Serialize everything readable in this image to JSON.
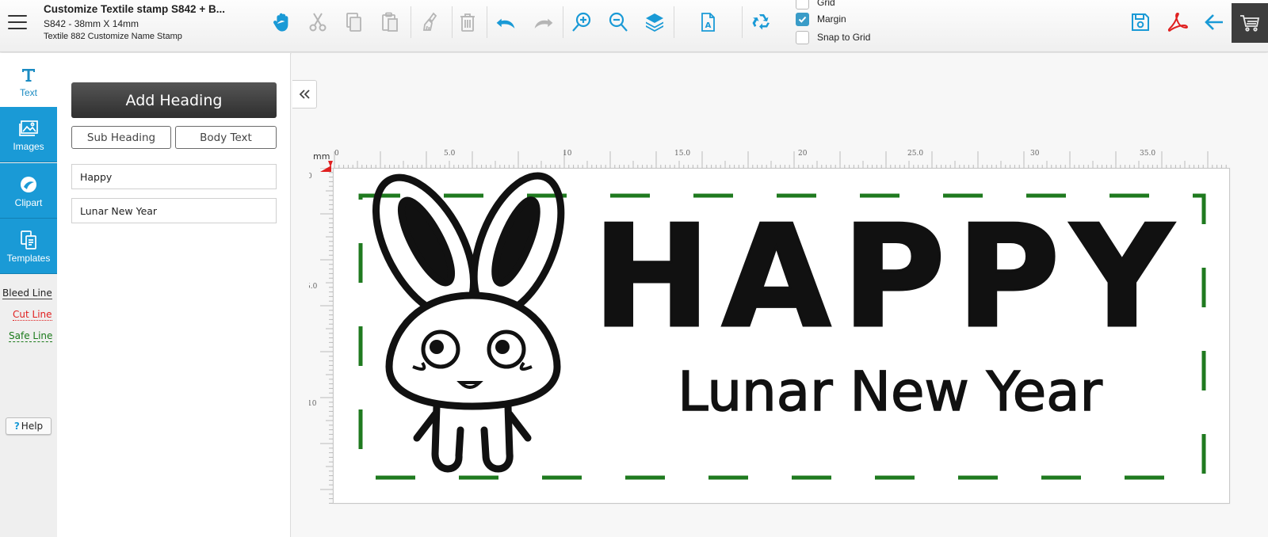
{
  "header": {
    "title": "Customize Textile stamp S842 + B...",
    "size_line": "S842 - 38mm X 14mm",
    "subtitle": "Textile 882 Customize Name Stamp"
  },
  "toolbar": {
    "icons": [
      "hand-icon",
      "cut-icon",
      "copy-icon",
      "paste-icon",
      "brush-icon",
      "trash-icon",
      "undo-icon",
      "redo-icon",
      "zoom-in-icon",
      "zoom-out-icon",
      "layers-icon",
      "text-file-icon",
      "recycle-icon"
    ],
    "options": [
      {
        "label": "Grid",
        "checked": false
      },
      {
        "label": "Margin",
        "checked": true
      },
      {
        "label": "Snap to Grid",
        "checked": false
      }
    ],
    "right_icons": [
      "save-icon",
      "pdf-icon",
      "back-arrow-icon",
      "cart-icon"
    ]
  },
  "leftnav": {
    "items": [
      {
        "label": "Text",
        "icon": "text-icon",
        "state": "active"
      },
      {
        "label": "Images",
        "icon": "image-icon",
        "state": "normal"
      },
      {
        "label": "Clipart",
        "icon": "clipart-icon",
        "state": "normal"
      },
      {
        "label": "Templates",
        "icon": "templates-icon",
        "state": "normal"
      }
    ],
    "legend": {
      "bleed": "Bleed Line",
      "cut": "Cut Line",
      "safe": "Safe Line"
    },
    "help_label": "Help"
  },
  "panel": {
    "add_heading": "Add Heading",
    "sub_heading": "Sub Heading",
    "body_text": "Body Text",
    "fields": [
      "Happy",
      "Lunar New Year"
    ]
  },
  "workspace": {
    "unit": "mm",
    "ruler_top_labels": [
      "0",
      "5.0",
      "10",
      "15.0",
      "20",
      "25.0",
      "30",
      "35.0"
    ],
    "ruler_left_labels": [
      "0",
      "5.0",
      "10"
    ],
    "design": {
      "heading": "HAPPY",
      "subheading": "Lunar New Year",
      "clipart": "bunny"
    }
  },
  "colors": {
    "accent": "#1a9ad6",
    "cut_line": "#e02020",
    "safe_line": "#1a7a1a",
    "margin_dash": "#1f7a1f"
  }
}
